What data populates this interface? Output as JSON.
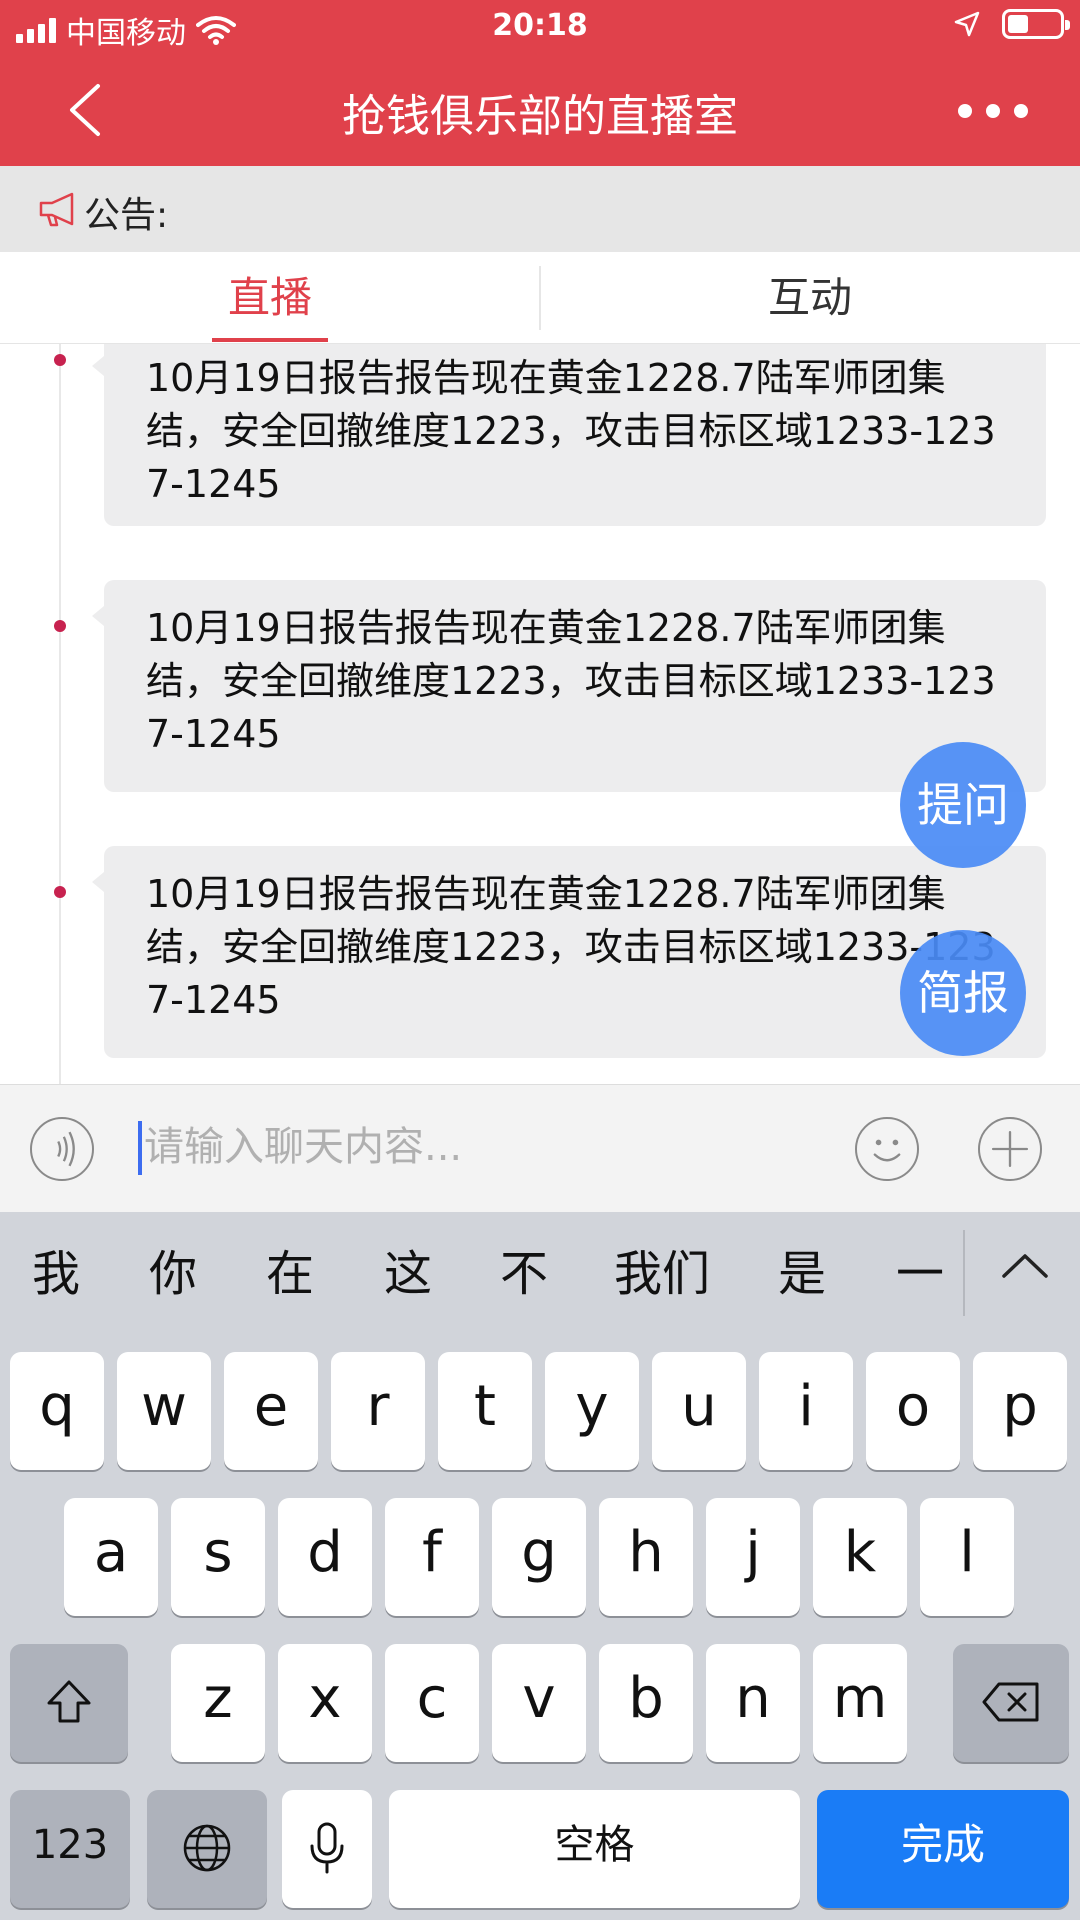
{
  "status_bar": {
    "carrier": "中国移动",
    "time": "20:18"
  },
  "nav": {
    "title": "抢钱俱乐部的直播室"
  },
  "notice": {
    "label": "公告:"
  },
  "tabs": [
    {
      "label": "直播"
    },
    {
      "label": "互动"
    }
  ],
  "feed": {
    "messages": [
      {
        "text": "10月19日报告报告现在黄金1228.7陆军师团集结，安全回撤维度1223，攻击目标区域1233-1237-1245"
      },
      {
        "text": "10月19日报告报告现在黄金1228.7陆军师团集结，安全回撤维度1223，攻击目标区域1233-1237-1245"
      },
      {
        "text": "10月19日报告报告现在黄金1228.7陆军师团集结，安全回撤维度1223，攻击目标区域1233-1237-1245"
      }
    ]
  },
  "fab": {
    "ask": "提问",
    "brief": "简报"
  },
  "input": {
    "placeholder": "请输入聊天内容..."
  },
  "keyboard": {
    "candidates": [
      "我",
      "你",
      "在",
      "这",
      "不",
      "我们",
      "是",
      "一"
    ],
    "row1": [
      "q",
      "w",
      "e",
      "r",
      "t",
      "y",
      "u",
      "i",
      "o",
      "p"
    ],
    "row2": [
      "a",
      "s",
      "d",
      "f",
      "g",
      "h",
      "j",
      "k",
      "l"
    ],
    "row3": [
      "z",
      "x",
      "c",
      "v",
      "b",
      "n",
      "m"
    ],
    "numbers_label": "123",
    "space_label": "空格",
    "done_label": "完成"
  },
  "colors": {
    "brand_red": "#e0414b",
    "fab_blue": "#4a8bf5",
    "done_blue": "#1a7cf6",
    "timeline_dot": "#c7224f"
  },
  "icons": [
    "back-icon",
    "more-icon",
    "megaphone-icon",
    "voice-icon",
    "emoji-icon",
    "plus-icon",
    "shift-icon",
    "delete-icon",
    "globe-icon",
    "microphone-icon",
    "wifi-icon",
    "location-icon",
    "battery-icon",
    "signal-icon",
    "chevron-up-icon"
  ]
}
